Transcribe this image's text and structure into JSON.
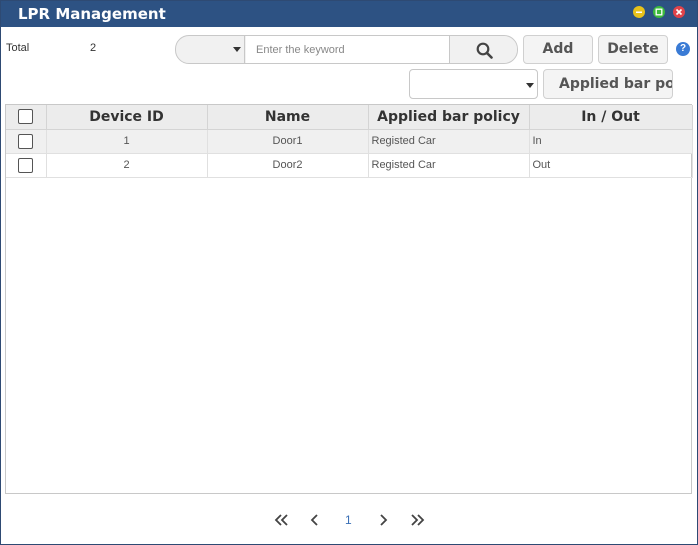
{
  "window": {
    "title": "LPR Management",
    "colors": {
      "titlebar": "#2d5283",
      "minimize": "#e8c21a",
      "maximize": "#3cba3c",
      "close": "#e0434a"
    }
  },
  "summary": {
    "total_label": "Total",
    "total_value": "2"
  },
  "search": {
    "field_value": "",
    "placeholder": "Enter the keyword",
    "button_icon": "search-icon"
  },
  "toolbar": {
    "add_label": "Add",
    "delete_label": "Delete",
    "help_icon": "help-icon",
    "policy_select_value": "",
    "policy_button_label": "Applied bar policy"
  },
  "table": {
    "columns": [
      "Device ID",
      "Name",
      "Applied bar policy",
      "In / Out"
    ],
    "rows": [
      {
        "device_id": "1",
        "name": "Door1",
        "policy": "Registed Car",
        "in_out": "In"
      },
      {
        "device_id": "2",
        "name": "Door2",
        "policy": "Registed Car",
        "in_out": "Out"
      }
    ]
  },
  "pagination": {
    "current_page": "1"
  }
}
